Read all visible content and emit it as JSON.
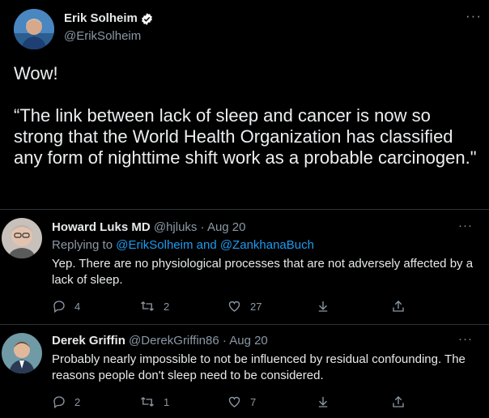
{
  "main_tweet": {
    "author_name": "Erik Solheim",
    "author_handle": "@ErikSolheim",
    "line1": "Wow!",
    "quote": "“The link between lack of sleep and cancer is now so strong that the World Health Organization has classified any form of nighttime shift work as a probable carcinogen.\""
  },
  "replies": [
    {
      "name": "Howard Luks MD",
      "handle": "@hjluks",
      "separator": "·",
      "date": "Aug 20",
      "replying_prefix": "Replying to ",
      "replying_mentions": "@ErikSolheim and @ZankhanaBuch",
      "text": "Yep. There are no physiological processes that are not adversely affected by a lack of sleep.",
      "reply_count": "4",
      "retweet_count": "2",
      "like_count": "27"
    },
    {
      "name": "Derek Griffin",
      "handle": "@DerekGriffin86",
      "separator": "·",
      "date": "Aug 20",
      "text": "Probably nearly impossible to not be influenced by residual confounding. The reasons people don't sleep need to be considered.",
      "reply_count": "2",
      "retweet_count": "1",
      "like_count": "7"
    }
  ],
  "colors": {
    "background": "#000000",
    "text": "#e7e9ea",
    "muted": "#8b98a5",
    "link": "#1d9bf0",
    "verified": "#ffffff"
  },
  "icons": [
    "verified-badge-icon",
    "more-icon",
    "reply-icon",
    "retweet-icon",
    "like-icon",
    "share-icon",
    "upload-icon"
  ]
}
